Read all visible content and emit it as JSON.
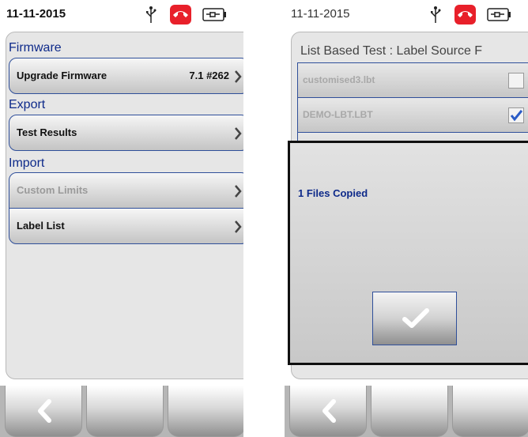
{
  "left_screen": {
    "status": {
      "date": "11-11-2015",
      "icons": [
        "usb-icon",
        "phone-icon",
        "battery-icon"
      ]
    },
    "sections": {
      "firmware": {
        "header": "Firmware",
        "upgrade_label": "Upgrade Firmware",
        "upgrade_value": "7.1 #262"
      },
      "export": {
        "header": "Export",
        "test_results_label": "Test Results"
      },
      "import": {
        "header": "Import",
        "custom_limits_label": "Custom Limits",
        "label_list_label": "Label List"
      }
    }
  },
  "right_screen": {
    "status": {
      "date": "11-11-2015"
    },
    "title": "List Based Test : Label Source F",
    "files": [
      {
        "name": "customised3.lbt",
        "checked": false
      },
      {
        "name": "DEMO-LBT.LBT",
        "checked": true
      }
    ],
    "dialog": {
      "message": "1 Files Copied",
      "ok_icon": "checkmark-icon"
    }
  },
  "colors": {
    "section_header": "#0e2a8a",
    "accent_red": "#e8202a",
    "border_blue": "#2f4f9a"
  }
}
